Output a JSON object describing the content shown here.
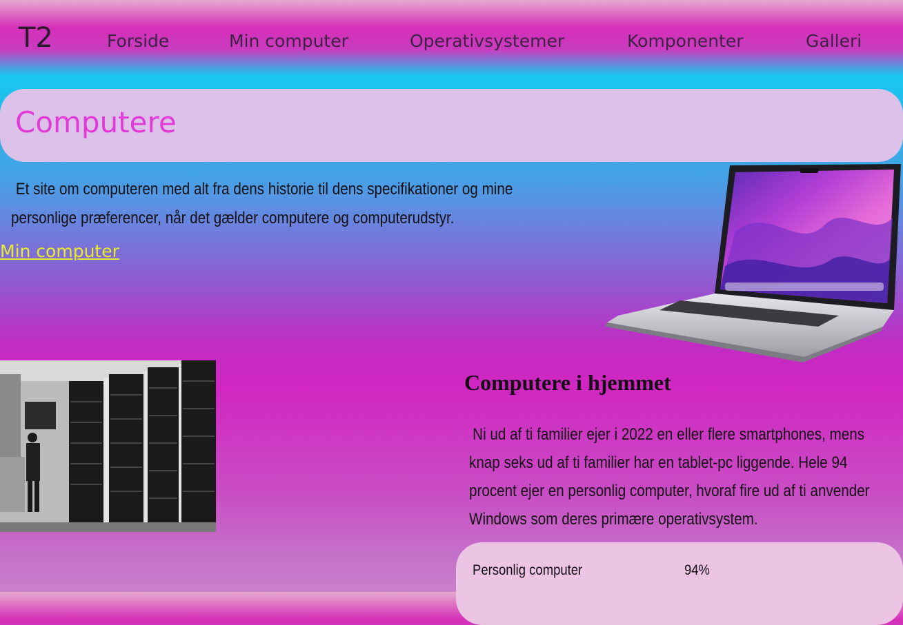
{
  "nav": {
    "logo": "T2",
    "links": [
      {
        "label": "Forside"
      },
      {
        "label": "Min computer"
      },
      {
        "label": "Operativsystemer"
      },
      {
        "label": "Komponenter"
      },
      {
        "label": "Galleri"
      }
    ]
  },
  "header": {
    "title": "Computere"
  },
  "intro": {
    "text": "Et site om computeren med alt fra dens historie til dens specifikationer og mine personlige præferencer, når det gælder computere og computerudstyr.",
    "link_label": "Min computer"
  },
  "home_section": {
    "title": "Computere i hjemmet",
    "text": "Ni ud af ti familier ejer i 2022 en eller flere smartphones, mens knap seks ud af ti familier har en tablet-pc liggende. Hele 94 procent ejer en personlig computer, hvoraf fire ud af ti anvender Windows som deres primære operativsystem."
  },
  "stats": {
    "rows": [
      {
        "label": "Personlig computer",
        "value": "94%"
      }
    ]
  },
  "colors": {
    "accent_title": "#e23ad8",
    "link_yellow": "#e8ec2a",
    "banner_bg": "#dcc1e8",
    "stats_bg": "#ecc4e4"
  }
}
